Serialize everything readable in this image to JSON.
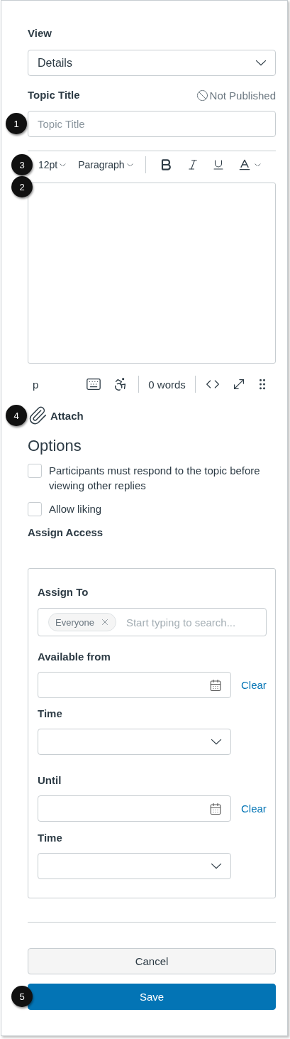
{
  "view": {
    "label": "View",
    "value": "Details"
  },
  "topic_title": {
    "label": "Topic Title",
    "status": "Not Published",
    "placeholder": "Topic Title",
    "callout": "1"
  },
  "toolbar": {
    "font_size": "12pt",
    "block": "Paragraph",
    "callout": "3"
  },
  "editor": {
    "callout": "2"
  },
  "editor_status": {
    "element": "p",
    "word_count": "0 words"
  },
  "attach": {
    "label": "Attach",
    "callout": "4"
  },
  "options": {
    "title": "Options",
    "items": [
      {
        "label": "Participants must respond to the topic before viewing other replies",
        "checked": false
      },
      {
        "label": "Allow liking",
        "checked": false
      }
    ]
  },
  "assign_access": {
    "title": "Assign Access",
    "assign_to": {
      "label": "Assign To",
      "chips": [
        "Everyone"
      ],
      "placeholder": "Start typing to search..."
    },
    "fields": [
      {
        "kind": "date",
        "label": "Available from",
        "clear": "Clear"
      },
      {
        "kind": "time",
        "label": "Time"
      },
      {
        "kind": "date",
        "label": "Until",
        "clear": "Clear"
      },
      {
        "kind": "time",
        "label": "Time"
      }
    ]
  },
  "buttons": {
    "cancel": "Cancel",
    "save": "Save",
    "save_callout": "5"
  }
}
